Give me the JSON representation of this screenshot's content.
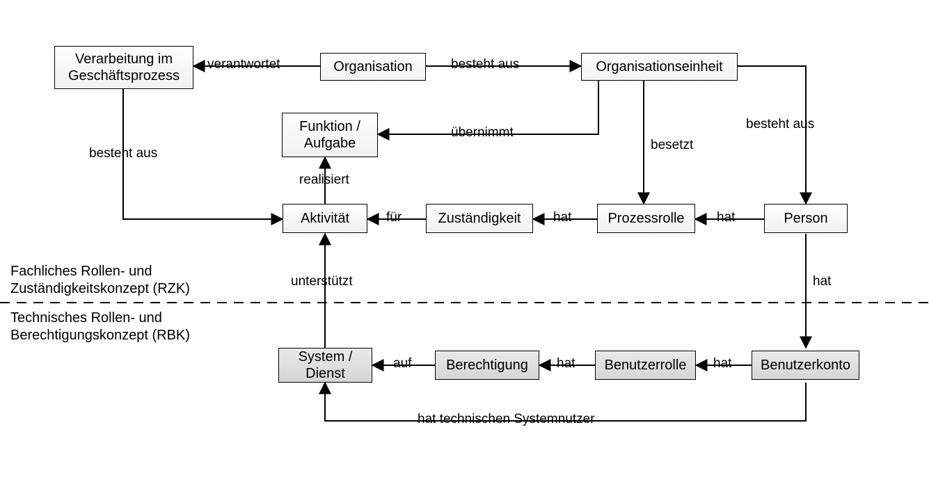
{
  "sections": {
    "upper": "Fachliches Rollen- und\nZuständigkeitskonzept (RZK)",
    "lower": "Technisches Rollen- und\nBerechtigungskonzept (RBK)"
  },
  "nodes": {
    "verarbeitung": "Verarbeitung im\nGeschäftsprozess",
    "organisation": "Organisation",
    "orgeinheit": "Organisationseinheit",
    "funktion": "Funktion /\nAufgabe",
    "aktivitaet": "Aktivität",
    "zustaendigkeit": "Zuständigkeit",
    "prozessrolle": "Prozessrolle",
    "person": "Person",
    "systemdienst": "System /\nDienst",
    "berechtigung": "Berechtigung",
    "benutzerrolle": "Benutzerrolle",
    "benutzerkonto": "Benutzerkonto"
  },
  "edges": {
    "verantwortet": "verantwortet",
    "besteht_aus_org": "besteht aus",
    "besteht_aus_person": "besteht aus",
    "besteht_aus_verarb": "besteht aus",
    "uebernimmt": "übernimmt",
    "besetzt": "besetzt",
    "realisiert": "realisiert",
    "fuer": "für",
    "hat_prozessrolle": "hat",
    "hat_person": "hat",
    "hat_benutzerkonto": "hat",
    "unterstuetzt": "unterstützt",
    "auf": "auf",
    "hat_berechtigung": "hat",
    "hat_benutzerrolle": "hat",
    "hat_systemnutzer": "hat technischen Systemnutzer"
  }
}
